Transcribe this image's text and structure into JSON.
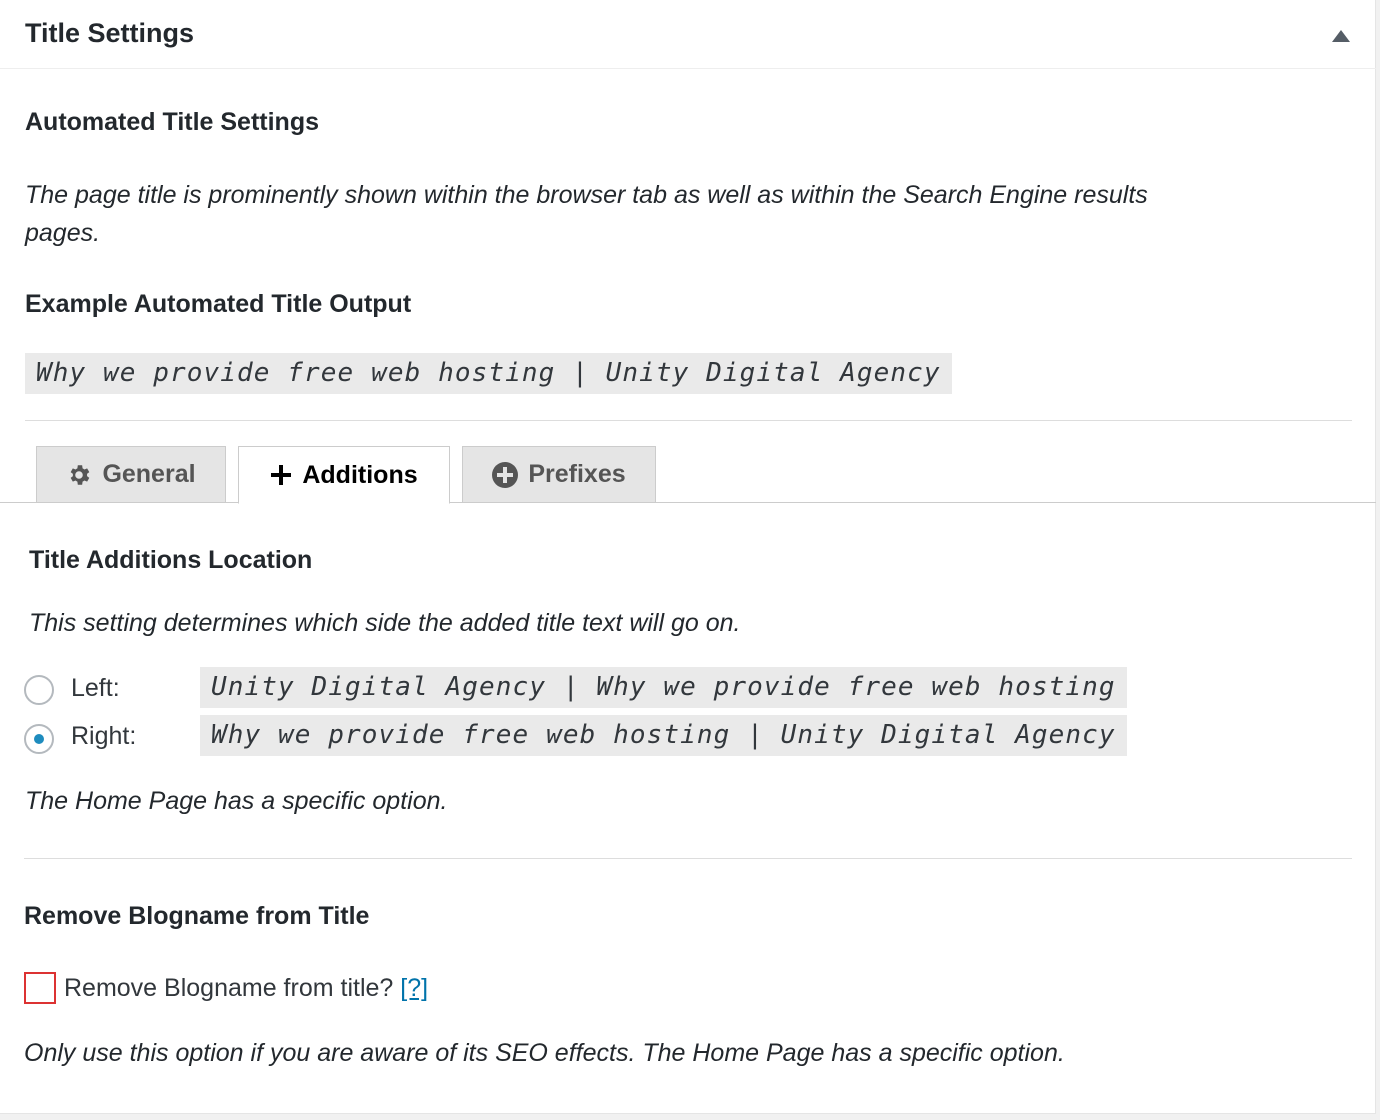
{
  "panel": {
    "title": "Title Settings",
    "toggle_icon": "triangle-up-icon"
  },
  "automated": {
    "heading": "Automated Title Settings",
    "description_line1": "The page title is prominently shown within the browser tab as well as within the Search Engine results",
    "description_line2": "pages.",
    "example_heading": "Example Automated Title Output",
    "example_output": "Why we provide free web hosting | Unity Digital Agency"
  },
  "tabs": [
    {
      "label": "General",
      "icon": "gear-icon",
      "active": false
    },
    {
      "label": "Additions",
      "icon": "plus-icon",
      "active": true
    },
    {
      "label": "Prefixes",
      "icon": "plus-circle-icon",
      "active": false
    }
  ],
  "additions": {
    "heading": "Title Additions Location",
    "description": "This setting determines which side the added title text will go on.",
    "options": [
      {
        "label": "Left:",
        "example": "Unity Digital Agency | Why we provide free web hosting",
        "checked": false
      },
      {
        "label": "Right:",
        "example": "Why we provide free web hosting | Unity Digital Agency",
        "checked": true
      }
    ],
    "note": "The Home Page has a specific option."
  },
  "blogname": {
    "heading": "Remove Blogname from Title",
    "checkbox_label": "Remove Blogname from title?",
    "checked": false,
    "help_link": "[?]",
    "note": "Only use this option if you are aware of its SEO effects. The Home Page has a specific option."
  },
  "colors": {
    "accent": "#1e8cbe",
    "link": "#0073aa",
    "checkbox_border": "#dc3232"
  }
}
